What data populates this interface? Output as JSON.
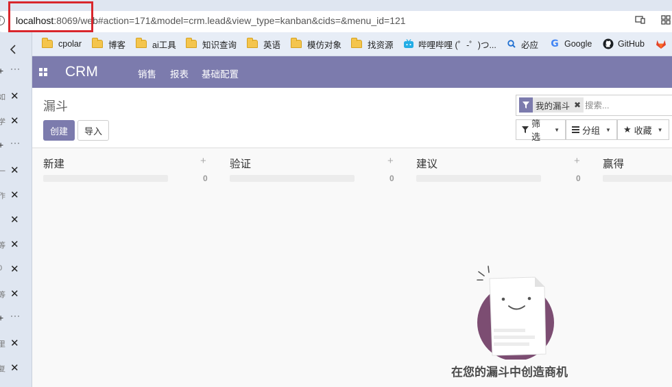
{
  "browser": {
    "url_host": "localhost",
    "url_rest": ":8069/web#action=171&model=crm.lead&view_type=kanban&cids=&menu_id=121",
    "info_glyph": "i"
  },
  "bookmarks": [
    {
      "label": "cpolar",
      "icon": "folder-icon"
    },
    {
      "label": "博客",
      "icon": "folder-icon"
    },
    {
      "label": "ai工具",
      "icon": "folder-icon"
    },
    {
      "label": "知识查询",
      "icon": "folder-icon"
    },
    {
      "label": "英语",
      "icon": "folder-icon"
    },
    {
      "label": "模仿对象",
      "icon": "folder-icon"
    },
    {
      "label": "找资源",
      "icon": "folder-icon"
    },
    {
      "label": "哔哩哔哩 (゜-゜)つ...",
      "icon": "bilibili-icon"
    },
    {
      "label": "必应",
      "icon": "bing-search-icon"
    },
    {
      "label": "Google",
      "icon": "google-icon"
    },
    {
      "label": "GitHub",
      "icon": "github-icon"
    }
  ],
  "sidebar": {
    "rows": [
      {
        "frag": "+",
        "kind": "plus"
      },
      {
        "frag": "如",
        "kind": "tab"
      },
      {
        "frag": "学",
        "kind": "tab"
      },
      {
        "frag": "+",
        "kind": "plus"
      },
      {
        "frag": "一",
        "kind": "tab"
      },
      {
        "frag": "作",
        "kind": "tab"
      },
      {
        "frag": "·",
        "kind": "tab"
      },
      {
        "frag": "等",
        "kind": "tab"
      },
      {
        "frag": "0",
        "kind": "tab"
      },
      {
        "frag": "等",
        "kind": "tab"
      },
      {
        "frag": "+",
        "kind": "plus"
      },
      {
        "frag": "里",
        "kind": "tab"
      },
      {
        "frag": "复",
        "kind": "tab"
      }
    ]
  },
  "app": {
    "brand": "CRM",
    "menu": [
      "销售",
      "报表",
      "基础配置"
    ]
  },
  "control_panel": {
    "title": "漏斗",
    "create_label": "创建",
    "import_label": "导入",
    "facet_label": "我的漏斗",
    "search_placeholder": "搜索...",
    "filter_label": "筛选",
    "group_label": "分组",
    "favorite_label": "收藏"
  },
  "kanban": {
    "columns": [
      {
        "title": "新建",
        "count": "0"
      },
      {
        "title": "验证",
        "count": "0"
      },
      {
        "title": "建议",
        "count": "0"
      },
      {
        "title": "赢得",
        "count": ""
      }
    ],
    "helper_text": "在您的漏斗中创造商机"
  },
  "colors": {
    "brand_purple": "#7c7bad",
    "highlight_red": "#d9262c",
    "helper_circle": "#7c4d72"
  }
}
